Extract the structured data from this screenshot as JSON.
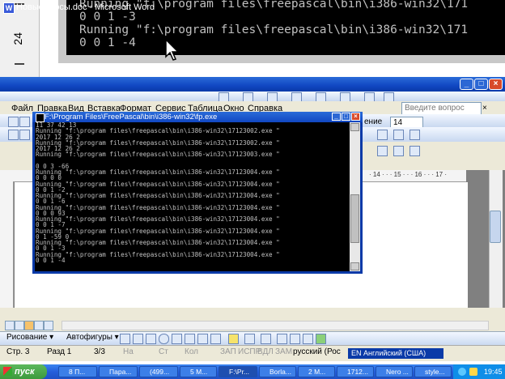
{
  "background": {
    "ruler_number": "24",
    "lines": [
      "Running \"f:\\program files\\freepascal\\bin\\i386-win32\\171",
      "0 0 1 -3",
      "Running \"f:\\program files\\freepascal\\bin\\i386-win32\\171",
      "0 0 1 -4"
    ]
  },
  "word": {
    "title": "Новые курсы.doc - Microsoft Word",
    "menu": [
      "Файл",
      "Правка",
      "Вид",
      "Вставка",
      "Формат",
      "Сервис",
      "Таблица",
      "Окно",
      "Справка"
    ],
    "help_placeholder": "Введите вопрос",
    "font_size": "14",
    "partial_label": "ение",
    "ruler_text": "· 14 · · · 15 · · · 16 · · · 17 ·"
  },
  "console": {
    "title": "F:\\Program Files\\FreePascal\\bin\\i386-win32\\fp.exe",
    "lines": [
      "11 37 42 13",
      "Running \"f:\\program files\\freepascal\\bin\\i386-win32\\17123002.exe \"",
      "2017 12 26 2",
      "Running \"f:\\program files\\freepascal\\bin\\i386-win32\\17123002.exe \"",
      "2017 12 26 2",
      "Running \"f:\\program files\\freepascal\\bin\\i386-win32\\17123003.exe \"",
      "",
      "0 0 3 -66",
      "Running \"f:\\program files\\freepascal\\bin\\i386-win32\\17123004.exe \"",
      "0 0 0 0",
      "Running \"f:\\program files\\freepascal\\bin\\i386-win32\\17123004.exe \"",
      "0 0 1 -2",
      "Running \"f:\\program files\\freepascal\\bin\\i386-win32\\17123004.exe \"",
      "0 0 1 -6",
      "Running \"f:\\program files\\freepascal\\bin\\i386-win32\\17123004.exe \"",
      "0 0 0 93",
      "Running \"f:\\program files\\freepascal\\bin\\i386-win32\\17123004.exe \"",
      "0 0 1 -7",
      "Running \"f:\\program files\\freepascal\\bin\\i386-win32\\17123004.exe \"",
      "0 1 -59 0",
      "Running \"f:\\program files\\freepascal\\bin\\i386-win32\\17123004.exe \"",
      "0 0 1 -3",
      "Running \"f:\\program files\\freepascal\\bin\\i386-win32\\17123004.exe \"",
      "0 0 1 -4"
    ]
  },
  "drawing_toolbar": {
    "draw_label": "Рисование ▾",
    "autoshapes_label": "Автофигуры ▾"
  },
  "status": {
    "page": "Стр. 3",
    "section": "Разд 1",
    "pages": "3/3",
    "at": "На",
    "line": "Ст",
    "col": "Кол",
    "rec": "ЗАП",
    "trk": "ИСПР",
    "ext": "ВДЛ",
    "ovr": "ЗАМ",
    "language": "русский (Рос",
    "input_language": "EN Английский (США)"
  },
  "taskbar": {
    "start": "пуск",
    "tasks": [
      "8 П...",
      "Пара...",
      "(499...",
      "5 М...",
      "F:\\Pr...",
      "Borla...",
      "2 M...",
      "1712...",
      "Nero ...",
      "style..."
    ],
    "clock": "19:45"
  },
  "colors": {
    "xp_blue": "#245edb",
    "console_bg": "#000000",
    "console_text": "#c0c0c0"
  }
}
